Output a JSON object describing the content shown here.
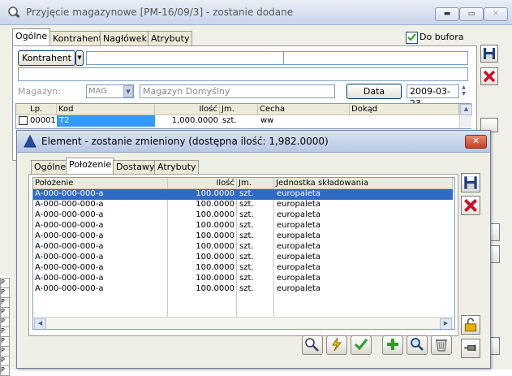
{
  "main_window": {
    "title": "Przyjęcie magazynowe [PM-16/09/3]  - zostanie dodane",
    "tabs": [
      "Ogólne",
      "Kontrahent",
      "Nagłówek",
      "Atrybuty"
    ],
    "do_bufora_label": "Do bufora",
    "kontrahent_button": "Kontrahent",
    "magazyn_label": "Magazyn:",
    "magazyn_code": "MAG",
    "magazyn_name": "Magazyn Domyślny",
    "data_button": "Data",
    "date_value": "2009-03-23",
    "columns": [
      "Lp.",
      "Kod",
      "Ilość",
      "Jm.",
      "Cecha",
      "Dokąd"
    ],
    "row": {
      "lp": "00001",
      "kod": "T2",
      "ilosc": "1,000.0000",
      "jm": "szt.",
      "cecha": "ww",
      "dokad": ""
    }
  },
  "left_strip_chars": [
    "P",
    "P",
    "P",
    "P",
    "P",
    "P",
    "P",
    "P",
    "P",
    "P"
  ],
  "dialog": {
    "title": "Element - zostanie zmieniony (dostępna ilość: 1,982.0000)",
    "tabs": [
      "Ogólne",
      "Położenie",
      "Dostawy",
      "Atrybuty"
    ],
    "columns": [
      "Położenie",
      "Ilość",
      "Jm.",
      "Jednostka składowania"
    ],
    "rows": [
      {
        "polozenie": "A-000-000-000-a",
        "ilosc": "100.0000",
        "jm": "szt.",
        "jednostka": "europaleta"
      },
      {
        "polozenie": "A-000-000-000-a",
        "ilosc": "100.0000",
        "jm": "szt.",
        "jednostka": "europaleta"
      },
      {
        "polozenie": "A-000-000-000-a",
        "ilosc": "100.0000",
        "jm": "szt.",
        "jednostka": "europaleta"
      },
      {
        "polozenie": "A-000-000-000-a",
        "ilosc": "100.0000",
        "jm": "szt.",
        "jednostka": "europaleta"
      },
      {
        "polozenie": "A-000-000-000-a",
        "ilosc": "100.0000",
        "jm": "szt.",
        "jednostka": "europaleta"
      },
      {
        "polozenie": "A-000-000-000-a",
        "ilosc": "100.0000",
        "jm": "szt.",
        "jednostka": "europaleta"
      },
      {
        "polozenie": "A-000-000-000-a",
        "ilosc": "100.0000",
        "jm": "szt.",
        "jednostka": "europaleta"
      },
      {
        "polozenie": "A-000-000-000-a",
        "ilosc": "100.0000",
        "jm": "szt.",
        "jednostka": "europaleta"
      },
      {
        "polozenie": "A-000-000-000-a",
        "ilosc": "100.0000",
        "jm": "szt.",
        "jednostka": "europaleta"
      },
      {
        "polozenie": "A-000-000-000-a",
        "ilosc": "100.0000",
        "jm": "szt.",
        "jednostka": "europaleta"
      }
    ],
    "selected_row": 0
  },
  "colors": {
    "selection": "#316ac5",
    "cancel_red": "#c8102e",
    "ok_green": "#2e9a2e"
  }
}
